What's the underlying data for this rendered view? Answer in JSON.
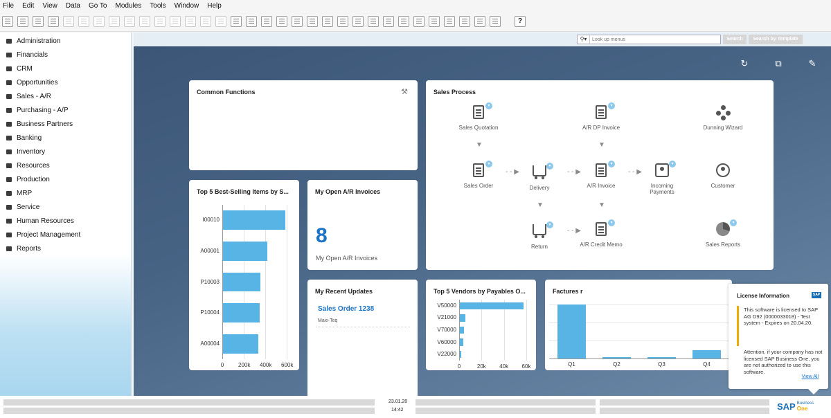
{
  "menu": [
    "File",
    "Edit",
    "View",
    "Data",
    "Go To",
    "Modules",
    "Tools",
    "Window",
    "Help"
  ],
  "toolbar": {
    "help_label": "?"
  },
  "sidebar": {
    "items": [
      {
        "label": "Administration",
        "icon": "admin-icon"
      },
      {
        "label": "Financials",
        "icon": "financials-icon"
      },
      {
        "label": "CRM",
        "icon": "crm-icon"
      },
      {
        "label": "Opportunities",
        "icon": "opportunities-icon"
      },
      {
        "label": "Sales - A/R",
        "icon": "sales-icon"
      },
      {
        "label": "Purchasing - A/P",
        "icon": "purchasing-icon"
      },
      {
        "label": "Business Partners",
        "icon": "business-partners-icon"
      },
      {
        "label": "Banking",
        "icon": "banking-icon"
      },
      {
        "label": "Inventory",
        "icon": "inventory-icon"
      },
      {
        "label": "Resources",
        "icon": "resources-icon"
      },
      {
        "label": "Production",
        "icon": "production-icon"
      },
      {
        "label": "MRP",
        "icon": "mrp-icon"
      },
      {
        "label": "Service",
        "icon": "service-icon"
      },
      {
        "label": "Human Resources",
        "icon": "human-resources-icon"
      },
      {
        "label": "Project Management",
        "icon": "project-management-icon"
      },
      {
        "label": "Reports",
        "icon": "reports-icon"
      }
    ]
  },
  "search": {
    "placeholder": "Look up menus",
    "search_button": "Search",
    "template_button": "Search by Template"
  },
  "actions": {
    "refresh": "↻",
    "gallery": "⧉",
    "edit": "✎"
  },
  "common_functions": {
    "title": "Common Functions"
  },
  "sales_process": {
    "title": "Sales Process",
    "nodes": {
      "sales_quotation": "Sales Quotation",
      "ar_dp_invoice": "A/R DP Invoice",
      "dunning_wizard": "Dunning Wizard",
      "sales_order": "Sales Order",
      "delivery": "Delivery",
      "ar_invoice": "A/R Invoice",
      "incoming_payments": "Incoming Payments",
      "customer": "Customer",
      "return": "Return",
      "ar_credit_memo": "A/R Credit Memo",
      "sales_reports": "Sales Reports"
    }
  },
  "top5_items": {
    "title": "Top 5 Best-Selling Items by S...",
    "chart_data": {
      "type": "bar",
      "orientation": "horizontal",
      "categories": [
        "I00010",
        "A00001",
        "P10003",
        "P10004",
        "A00004"
      ],
      "values": [
        580000,
        410000,
        350000,
        340000,
        330000
      ],
      "xlim": [
        0,
        600000
      ],
      "xticks": [
        "0",
        "200k",
        "400k",
        "600k"
      ],
      "grid": true
    }
  },
  "open_invoices": {
    "title": "My Open A/R Invoices",
    "count": "8",
    "caption": "My Open A/R Invoices"
  },
  "recent_updates": {
    "title": "My Recent Updates",
    "item_title": "Sales Order 1238",
    "item_subtitle": "Maxi-Teq"
  },
  "top5_vendors": {
    "title": "Top 5 Vendors by Payables O...",
    "chart_data": {
      "type": "bar",
      "orientation": "horizontal",
      "categories": [
        "V50000",
        "V21000",
        "V70000",
        "V60000",
        "V22000"
      ],
      "values": [
        57000,
        5000,
        4000,
        3000,
        1500
      ],
      "xlim": [
        0,
        60000
      ],
      "xticks": [
        "0",
        "20k",
        "40k",
        "60k"
      ],
      "grid": true
    }
  },
  "factures": {
    "title": "Factures r",
    "chart_data": {
      "type": "bar",
      "categories": [
        "Q1",
        "Q2",
        "Q3",
        "Q4"
      ],
      "values": [
        100,
        3,
        3,
        15
      ],
      "grid": true
    }
  },
  "license": {
    "title": "License Information",
    "body1": "This software is licensed to SAP AG D92 (0000033018) - Test system - Expires on 20.04.20.",
    "body2": "Attention, if your company has not licensed SAP Business One, you are not authorized to use this software.",
    "link": "View All"
  },
  "status": {
    "date": "23.01.20",
    "time": "14:42"
  },
  "brand": {
    "sap": "SAP",
    "business": "Business",
    "one": "One"
  },
  "colors": {
    "accent": "#1a73c6",
    "bar": "#57b4e4",
    "sap_blue": "#1a6fb5",
    "sap_gold": "#f0ab00"
  }
}
